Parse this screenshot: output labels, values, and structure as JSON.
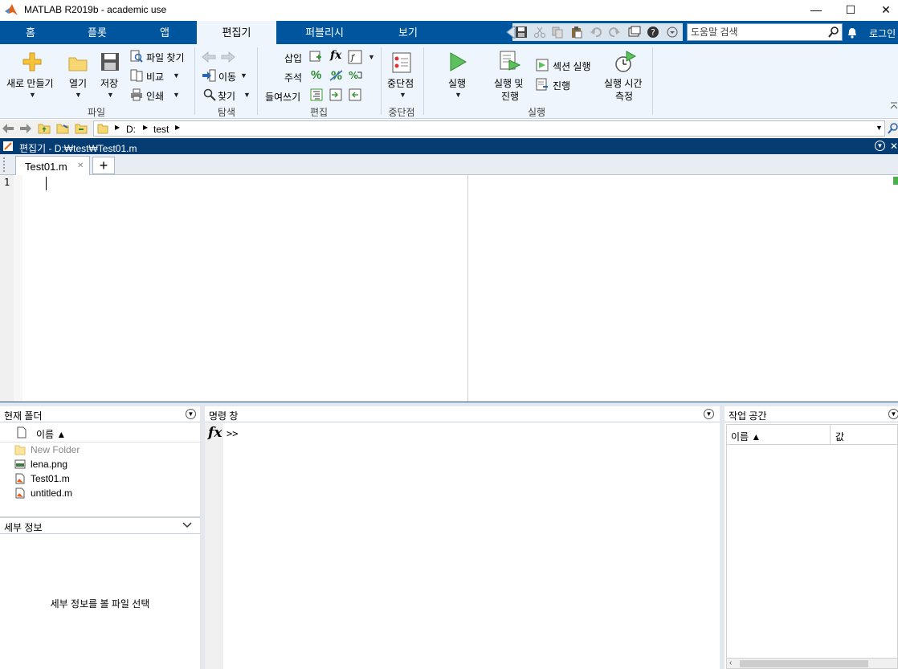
{
  "window": {
    "title": "MATLAB R2019b - academic use",
    "minimize": "—",
    "maximize": "☐",
    "close": "✕"
  },
  "tabs": [
    {
      "label": "홈"
    },
    {
      "label": "플롯"
    },
    {
      "label": "앱"
    },
    {
      "label": "편집기"
    },
    {
      "label": "퍼블리시"
    },
    {
      "label": "보기"
    }
  ],
  "search": {
    "placeholder": "도움말 검색"
  },
  "login": "로그인",
  "ribbon": {
    "file": {
      "new": "새로 만들기",
      "open": "열기",
      "save": "저장",
      "find_files": "파일 찾기",
      "compare": "비교",
      "print": "인쇄",
      "group": "파일"
    },
    "navigate": {
      "goto": "이동",
      "find": "찾기",
      "group": "탐색"
    },
    "edit": {
      "insert": "삽입",
      "fx": "fx",
      "comment": "주석",
      "indent": "들여쓰기",
      "group": "편집"
    },
    "breakpoints": {
      "label": "중단점",
      "group": "중단점"
    },
    "run": {
      "run": "실행",
      "run_advance_1": "실행 및",
      "run_advance_2": "진행",
      "run_section": "섹션 실행",
      "advance": "진행",
      "run_time_1": "실행 시간",
      "run_time_2": "측정",
      "group": "실행"
    }
  },
  "address": {
    "drive": "D:",
    "folder": "test"
  },
  "editor": {
    "title": "편집기 - D:₩test₩Test01.m",
    "tab": "Test01.m",
    "tab_close": "✕",
    "new_tab": "+",
    "line_number": "1"
  },
  "current_folder": {
    "title": "현재 폴더",
    "column_name": "이름 ▲",
    "files": [
      {
        "name": "New Folder",
        "type": "folder"
      },
      {
        "name": "lena.png",
        "type": "png"
      },
      {
        "name": "Test01.m",
        "type": "m"
      },
      {
        "name": "untitled.m",
        "type": "m"
      }
    ]
  },
  "details": {
    "title": "세부 정보",
    "message": "세부 정보를 볼 파일 선택"
  },
  "command_window": {
    "title": "명령 창",
    "fx": "fx",
    "prompt": ">>"
  },
  "workspace": {
    "title": "작업 공간",
    "col_name": "이름 ▲",
    "col_value": "값"
  },
  "colors": {
    "tab_blue": "#00569e",
    "ribbon_bg": "#eef5fc",
    "editor_title": "#053d73"
  }
}
